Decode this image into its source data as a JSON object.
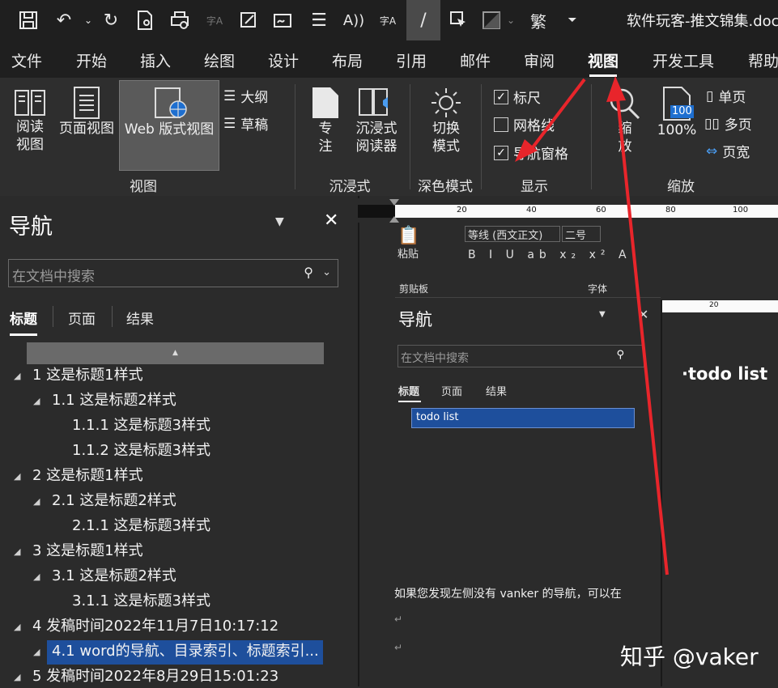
{
  "title_bar": {
    "document_title": "软件玩客-推文锦集.doc",
    "qat_icons": [
      "save-icon",
      "undo-icon",
      "redo-icon",
      "print-preview-icon",
      "print-icon",
      "pinyin-icon",
      "draw-table-icon",
      "signature-icon",
      "align-icon",
      "read-aloud-icon",
      "pinyin-check-icon",
      "pen-icon",
      "select-icon",
      "shading-icon",
      "traditional-chinese-icon",
      "customize-icon"
    ],
    "traditional_label": "繁"
  },
  "tabs": [
    "文件",
    "开始",
    "插入",
    "绘图",
    "设计",
    "布局",
    "引用",
    "邮件",
    "审阅",
    "视图",
    "开发工具",
    "帮助"
  ],
  "active_tab": "视图",
  "ribbon": {
    "read_mode": "阅读\n视图",
    "page_view": "页面视图",
    "web_view": "Web 版式视图",
    "outline": "大纲",
    "draft": "草稿",
    "group_view": "视图",
    "focus": "专\n注",
    "immersive_reader": "沉浸式\n阅读器",
    "group_immersive": "沉浸式",
    "switch_mode": "切换\n模式",
    "group_dark": "深色模式",
    "ruler": "标尺",
    "gridlines": "网格线",
    "nav_pane": "导航窗格",
    "ruler_checked": true,
    "gridlines_checked": false,
    "nav_pane_checked": true,
    "group_show": "显示",
    "zoom": "缩\n放",
    "zoom_100": "100%",
    "zoom_badge": "100",
    "single_page": "单页",
    "multi_page": "多页",
    "page_width": "页宽",
    "group_zoom": "缩放"
  },
  "nav": {
    "title": "导航",
    "search_placeholder": "在文档中搜索",
    "tabs": [
      "标题",
      "页面",
      "结果"
    ],
    "headings": [
      {
        "text": "1 这是标题1样式",
        "level": 1
      },
      {
        "text": "1.1 这是标题2样式",
        "level": 2
      },
      {
        "text": "1.1.1 这是标题3样式",
        "level": 3
      },
      {
        "text": "1.1.2 这是标题3样式",
        "level": 3
      },
      {
        "text": "2 这是标题1样式",
        "level": 1
      },
      {
        "text": "2.1 这是标题2样式",
        "level": 2
      },
      {
        "text": "2.1.1 这是标题3样式",
        "level": 3
      },
      {
        "text": "3 这是标题1样式",
        "level": 1
      },
      {
        "text": "3.1 这是标题2样式",
        "level": 2
      },
      {
        "text": "3.1.1 这是标题3样式",
        "level": 3
      },
      {
        "text": "4 发稿时间2022年11月7日10:17:12",
        "level": 1
      },
      {
        "text": "4.1 word的导航、目录索引、标题索引...",
        "level": 2,
        "selected": true
      },
      {
        "text": "5 发稿时间2022年8月29日15:01:23",
        "level": 1
      }
    ]
  },
  "ruler_ticks": [
    "20",
    "40",
    "60",
    "80",
    "100"
  ],
  "embedded": {
    "font_name": "等线 (西文正文)",
    "font_size": "二号",
    "paste": "粘贴",
    "clipboard": "剪贴板",
    "font_group": "字体",
    "nav_title": "导航",
    "search_placeholder": "在文档中搜索",
    "tabs": [
      "标题",
      "页面",
      "结果"
    ],
    "selected_heading": "todo list",
    "ruler_tick": "20",
    "doc_heading": "·todo list"
  },
  "doc_text": "如果您发现左侧没有 vanker 的导航，可以在",
  "watermark": "知乎 @vaker",
  "annotation_color": "#e8252b",
  "accent_selection": "#1e4f9c"
}
